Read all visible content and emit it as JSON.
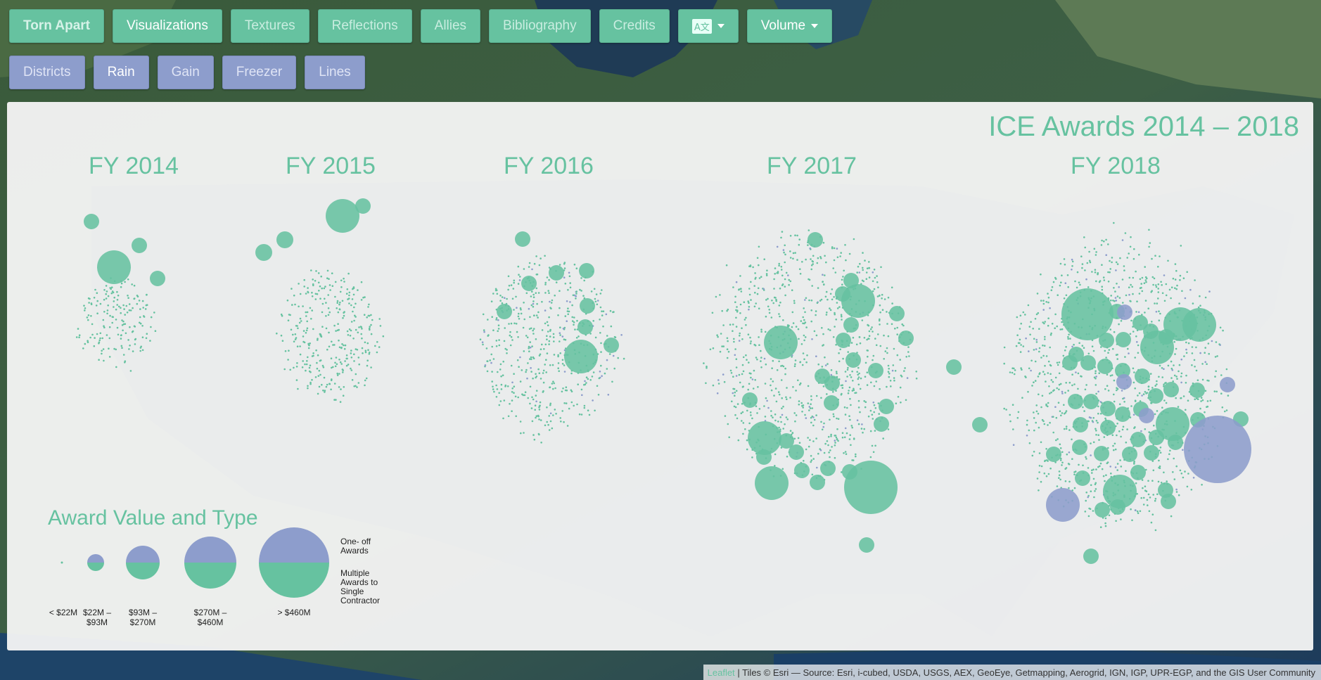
{
  "nav": {
    "brand": "Torn Apart",
    "visualizations": "Visualizations",
    "textures": "Textures",
    "reflections": "Reflections",
    "allies": "Allies",
    "bibliography": "Bibliography",
    "credits": "Credits",
    "language_icon": "A文",
    "volume": "Volume"
  },
  "subnav": {
    "districts": "Districts",
    "rain": "Rain",
    "gain": "Gain",
    "freezer": "Freezer",
    "lines": "Lines"
  },
  "panel": {
    "title": "ICE Awards 2014 – 2018",
    "years": [
      "FY 2014",
      "FY 2015",
      "FY 2016",
      "FY 2017",
      "FY 2018"
    ]
  },
  "legend": {
    "title": "Award Value and Type",
    "sizes": [
      "< $22M",
      "$22M – $93M",
      "$93M – $270M",
      "$270M – $460M",
      "> $460M"
    ],
    "key_top": "One- off Awards",
    "key_bottom": "Multiple Awards to Single Contractor"
  },
  "colors": {
    "multiple": "#66c2a0",
    "one_off": "#8d9dcc",
    "title": "#66c2a0"
  },
  "attribution": {
    "leaflet": "Leaflet",
    "tiles": "Tiles © Esri — Source: Esri, i-cubed, USDA, USGS, AEX, GeoEye, Getmapping, Aerogrid, IGN, IGP, UPR-EGP, and the GIS User Community"
  }
}
